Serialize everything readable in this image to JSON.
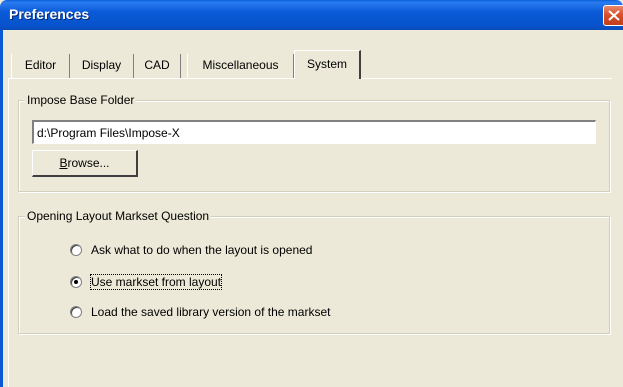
{
  "window": {
    "title": "Preferences"
  },
  "tabs": [
    {
      "label": "Editor",
      "active": false
    },
    {
      "label": "Display",
      "active": false
    },
    {
      "label": "CAD",
      "active": false
    },
    {
      "label": "Miscellaneous",
      "active": false
    },
    {
      "label": "System",
      "active": true
    }
  ],
  "impose_base": {
    "legend": "Impose Base Folder",
    "path_value": "d:\\Program Files\\Impose-X",
    "browse_label_underlined": "B",
    "browse_label_rest": "rowse..."
  },
  "markset_question": {
    "legend": "Opening Layout Markset Question",
    "options": [
      {
        "label": "Ask what to do when the layout is opened",
        "selected": false
      },
      {
        "label": "Use markset from layout",
        "selected": true
      },
      {
        "label": "Load the saved library version of the markset",
        "selected": false
      }
    ]
  },
  "colors": {
    "titlebar": "#0a58d4",
    "window_face": "#ece9d8",
    "close_button": "#d9502c"
  },
  "icons": {
    "close": "close-x-icon"
  }
}
